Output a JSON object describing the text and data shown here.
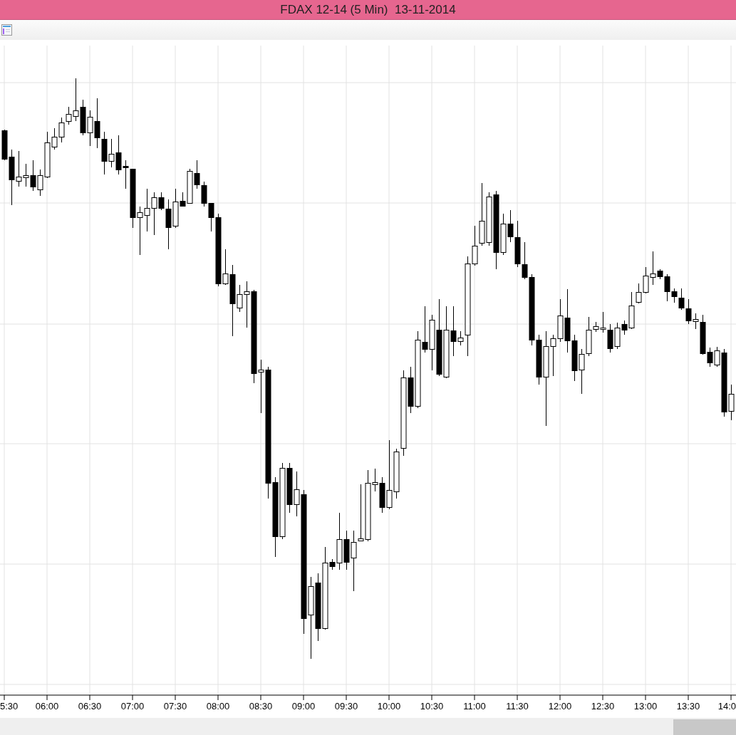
{
  "window": {
    "title": "FDAX 12-14 (5 Min)  13-11-2014"
  },
  "chart": {
    "x_axis_labels": [
      "5:30",
      "06:00",
      "06:30",
      "07:00",
      "07:30",
      "08:00",
      "08:30",
      "09:00",
      "09:30",
      "10:00",
      "10:30",
      "11:00",
      "11:30",
      "12:00",
      "12:30",
      "13:00",
      "13:30",
      "14:0"
    ]
  }
}
